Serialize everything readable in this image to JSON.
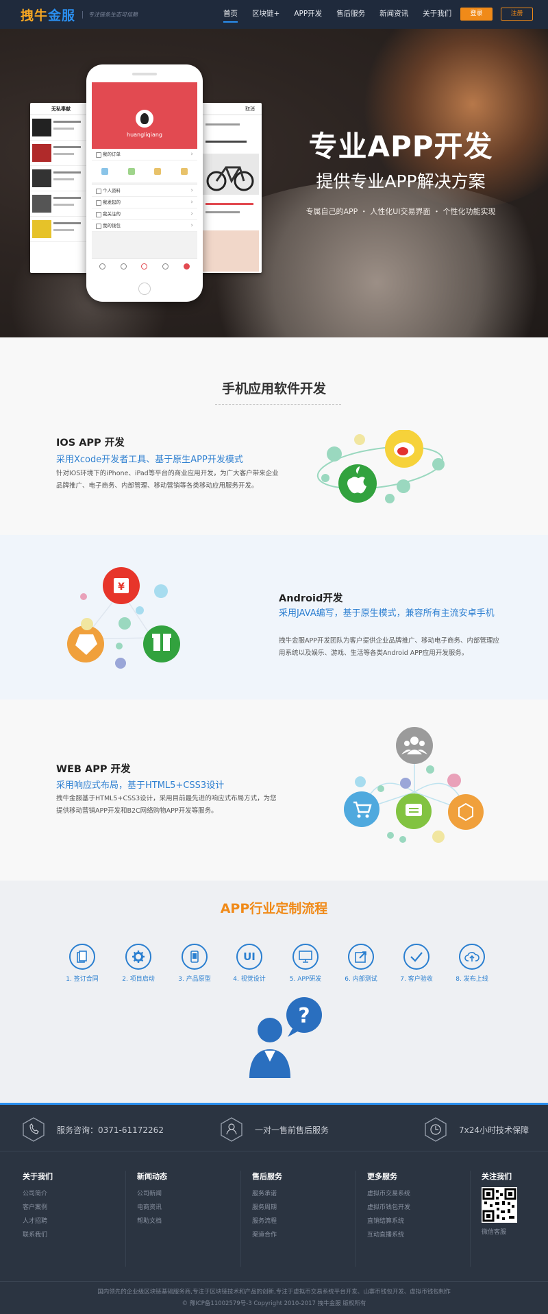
{
  "header": {
    "logo_main": "拽牛",
    "logo_sub": "金服",
    "slogan": "专注链条生态可信赖",
    "nav": [
      "首页",
      "区块链+",
      "APP开发",
      "售后服务",
      "新闻资讯",
      "关于我们"
    ],
    "login": "登录",
    "register": "注册"
  },
  "hero": {
    "title": "专业APP开发",
    "subtitle": "提供专业APP解决方案",
    "tags": "专属自己的APP ・ 人性化UI交易界面 ・ 个性化功能实现",
    "phone_username": "huangliqiang",
    "phone_rows": [
      "我的订单",
      "个人资料",
      "我发起的",
      "我关注的",
      "我的钱包"
    ],
    "left_card_title": "无私奉献",
    "right_card_title": "取消"
  },
  "mobile": {
    "title": "手机应用软件开发",
    "ios": {
      "title": "IOS APP 开发",
      "subtitle": "采用Xcode开发者工具、基于原生APP开发模式",
      "desc": "针对IOS环境下的iPhone、iPad等平台的商业应用开发，为广大客户带来企业品牌推广、电子商务、内部管理、移动营销等各类移动应用服务开发。"
    },
    "android": {
      "title": "Android开发",
      "subtitle": "采用JAVA编写，基于原生模式，兼容所有主流安卓手机",
      "desc": "拽牛金服APP开发团队为客户提供企业品牌推广、移动电子商务、内部管理应用系统以及娱乐、游戏、生活等各类Android APP应用开发服务。"
    },
    "web": {
      "title": "WEB APP 开发",
      "subtitle": "采用响应式布局，基于HTML5+CSS3设计",
      "desc": "拽牛金服基于HTML5+CSS3设计，采用目前最先进的响应式布局方式，为您提供移动营销APP开发和B2C网络购物APP开发等服务。"
    }
  },
  "process": {
    "title": "APP行业定制流程",
    "steps": [
      {
        "label": "1. 签订合同",
        "icon": "contract-icon"
      },
      {
        "label": "2. 项目启动",
        "icon": "gear-icon"
      },
      {
        "label": "3. 产品原型",
        "icon": "phone-icon"
      },
      {
        "label": "4. 视觉设计",
        "icon": "ui-icon",
        "glyph": "UI"
      },
      {
        "label": "5. APP研发",
        "icon": "monitor-icon"
      },
      {
        "label": "6. 内部测试",
        "icon": "edit-icon"
      },
      {
        "label": "7. 客户验收",
        "icon": "check-icon"
      },
      {
        "label": "8. 发布上线",
        "icon": "cloud-upload-icon"
      }
    ]
  },
  "footer": {
    "service_phone": "服务咨询：0371-61172262",
    "service_one": "一对一售前售后服务",
    "service_247": "7x24小时技术保障",
    "columns": [
      {
        "title": "关于我们",
        "links": [
          "公司简介",
          "客户案例",
          "人才招聘",
          "联系我们"
        ]
      },
      {
        "title": "新闻动态",
        "links": [
          "公司新闻",
          "电商资讯",
          "帮助文档"
        ]
      },
      {
        "title": "售后服务",
        "links": [
          "服务承诺",
          "服务周期",
          "服务流程",
          "渠道合作"
        ]
      },
      {
        "title": "更多服务",
        "links": [
          "虚拟币交易系统",
          "虚拟币钱包开发",
          "直销结算系统",
          "互动直播系统"
        ]
      }
    ],
    "follow_title": "关注我们",
    "follow_label": "微信客服",
    "bottom_line1": "国内领先的企业级区块链基础服务商,专注于区块链技术和产品的创新,专注于虚拟币交易系统平台开发、山寨币钱包开发、虚拟币钱包制作",
    "bottom_line2": "© 豫ICP备11002579号-3 Copyright 2010-2017 拽牛金服 版权所有"
  },
  "colors": {
    "accent_blue": "#2a8ff0",
    "accent_orange": "#f08a18",
    "header_bg": "#1f2a3c",
    "footer_bg": "#2b3441"
  }
}
